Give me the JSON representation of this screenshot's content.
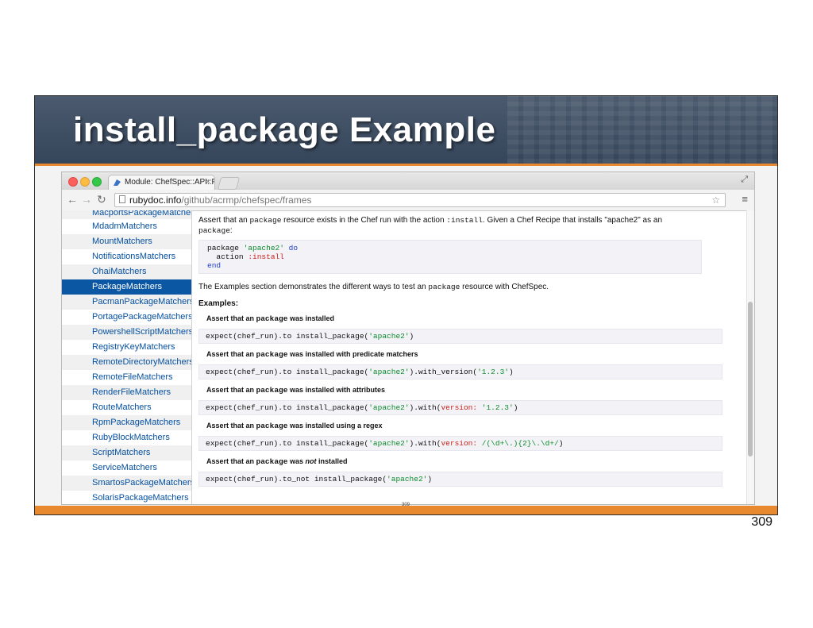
{
  "slide": {
    "title": "install_package Example",
    "page_number": "309",
    "tiny_mark": "309",
    "colors": {
      "title_bar": "#3e4e63",
      "accent": "#e8882f",
      "link": "#0550a0",
      "active_item": "#0b57a4"
    }
  },
  "browser": {
    "tab_title": "Module: ChefSpec::API::Pa",
    "tab_close": "×",
    "url_domain": "rubydoc.info",
    "url_path": "/github/acrmp/chefspec/frames",
    "icons": [
      "back-arrow-icon",
      "forward-arrow-icon",
      "reload-icon",
      "page-icon",
      "star-icon",
      "menu-icon",
      "expand-icon"
    ]
  },
  "sidebar": {
    "items": [
      "MacportsPackageMatcher",
      "MdadmMatchers",
      "MountMatchers",
      "NotificationsMatchers",
      "OhaiMatchers",
      "PackageMatchers",
      "PacmanPackageMatchers",
      "PortagePackageMatchers",
      "PowershellScriptMatchers",
      "RegistryKeyMatchers",
      "RemoteDirectoryMatchers",
      "RemoteFileMatchers",
      "RenderFileMatchers",
      "RouteMatchers",
      "RpmPackageMatchers",
      "RubyBlockMatchers",
      "ScriptMatchers",
      "ServiceMatchers",
      "SmartosPackageMatchers",
      "SolarisPackageMatchers"
    ],
    "active": "PackageMatchers"
  },
  "content": {
    "intro_1": "Assert that an ",
    "intro_code1": "package",
    "intro_2": " resource exists in the Chef run with the action ",
    "intro_code2": ":install",
    "intro_3": ". Given a Chef Recipe that installs \"apache2\" as an",
    "intro_code3": "package",
    "intro_4": ":",
    "code_line1_a": "package ",
    "code_line1_b": "'apache2'",
    "code_line1_c": " do",
    "code_line2_a": "  action ",
    "code_line2_b": ":install",
    "code_line3": "end",
    "examples_intro_1": "The Examples section demonstrates the different ways to test an ",
    "examples_intro_code": "package",
    "examples_intro_2": " resource with ChefSpec.",
    "examples_heading": "Examples:",
    "examples": [
      {
        "title_a": "Assert that an ",
        "title_code": "package",
        "title_b": " was installed",
        "title_em": "",
        "title_c": "",
        "code_a": "expect(chef_run).to install_package(",
        "code_str": "'apache2'",
        "code_b": ")",
        "code_sym": "",
        "code_str2": "",
        "code_c": ""
      },
      {
        "title_a": "Assert that an ",
        "title_code": "package",
        "title_b": " was installed with predicate matchers",
        "title_em": "",
        "title_c": "",
        "code_a": "expect(chef_run).to install_package(",
        "code_str": "'apache2'",
        "code_b": ").with_version(",
        "code_sym": "",
        "code_str2": "'1.2.3'",
        "code_c": ")"
      },
      {
        "title_a": "Assert that an ",
        "title_code": "package",
        "title_b": " was installed with attributes",
        "title_em": "",
        "title_c": "",
        "code_a": "expect(chef_run).to install_package(",
        "code_str": "'apache2'",
        "code_b": ").with(",
        "code_sym": "version:",
        "code_str2": " '1.2.3'",
        "code_c": ")"
      },
      {
        "title_a": "Assert that an ",
        "title_code": "package",
        "title_b": " was installed using a regex",
        "title_em": "",
        "title_c": "",
        "code_a": "expect(chef_run).to install_package(",
        "code_str": "'apache2'",
        "code_b": ").with(",
        "code_sym": "version:",
        "code_str2": " /(\\d+\\.){2}\\.\\d+/",
        "code_c": ")"
      },
      {
        "title_a": "Assert that an ",
        "title_code": "package",
        "title_b": " was ",
        "title_em": "not",
        "title_c": " installed",
        "code_a": "expect(chef_run).to_not install_package(",
        "code_str": "'apache2'",
        "code_b": ")",
        "code_sym": "",
        "code_str2": "",
        "code_c": ""
      }
    ]
  }
}
